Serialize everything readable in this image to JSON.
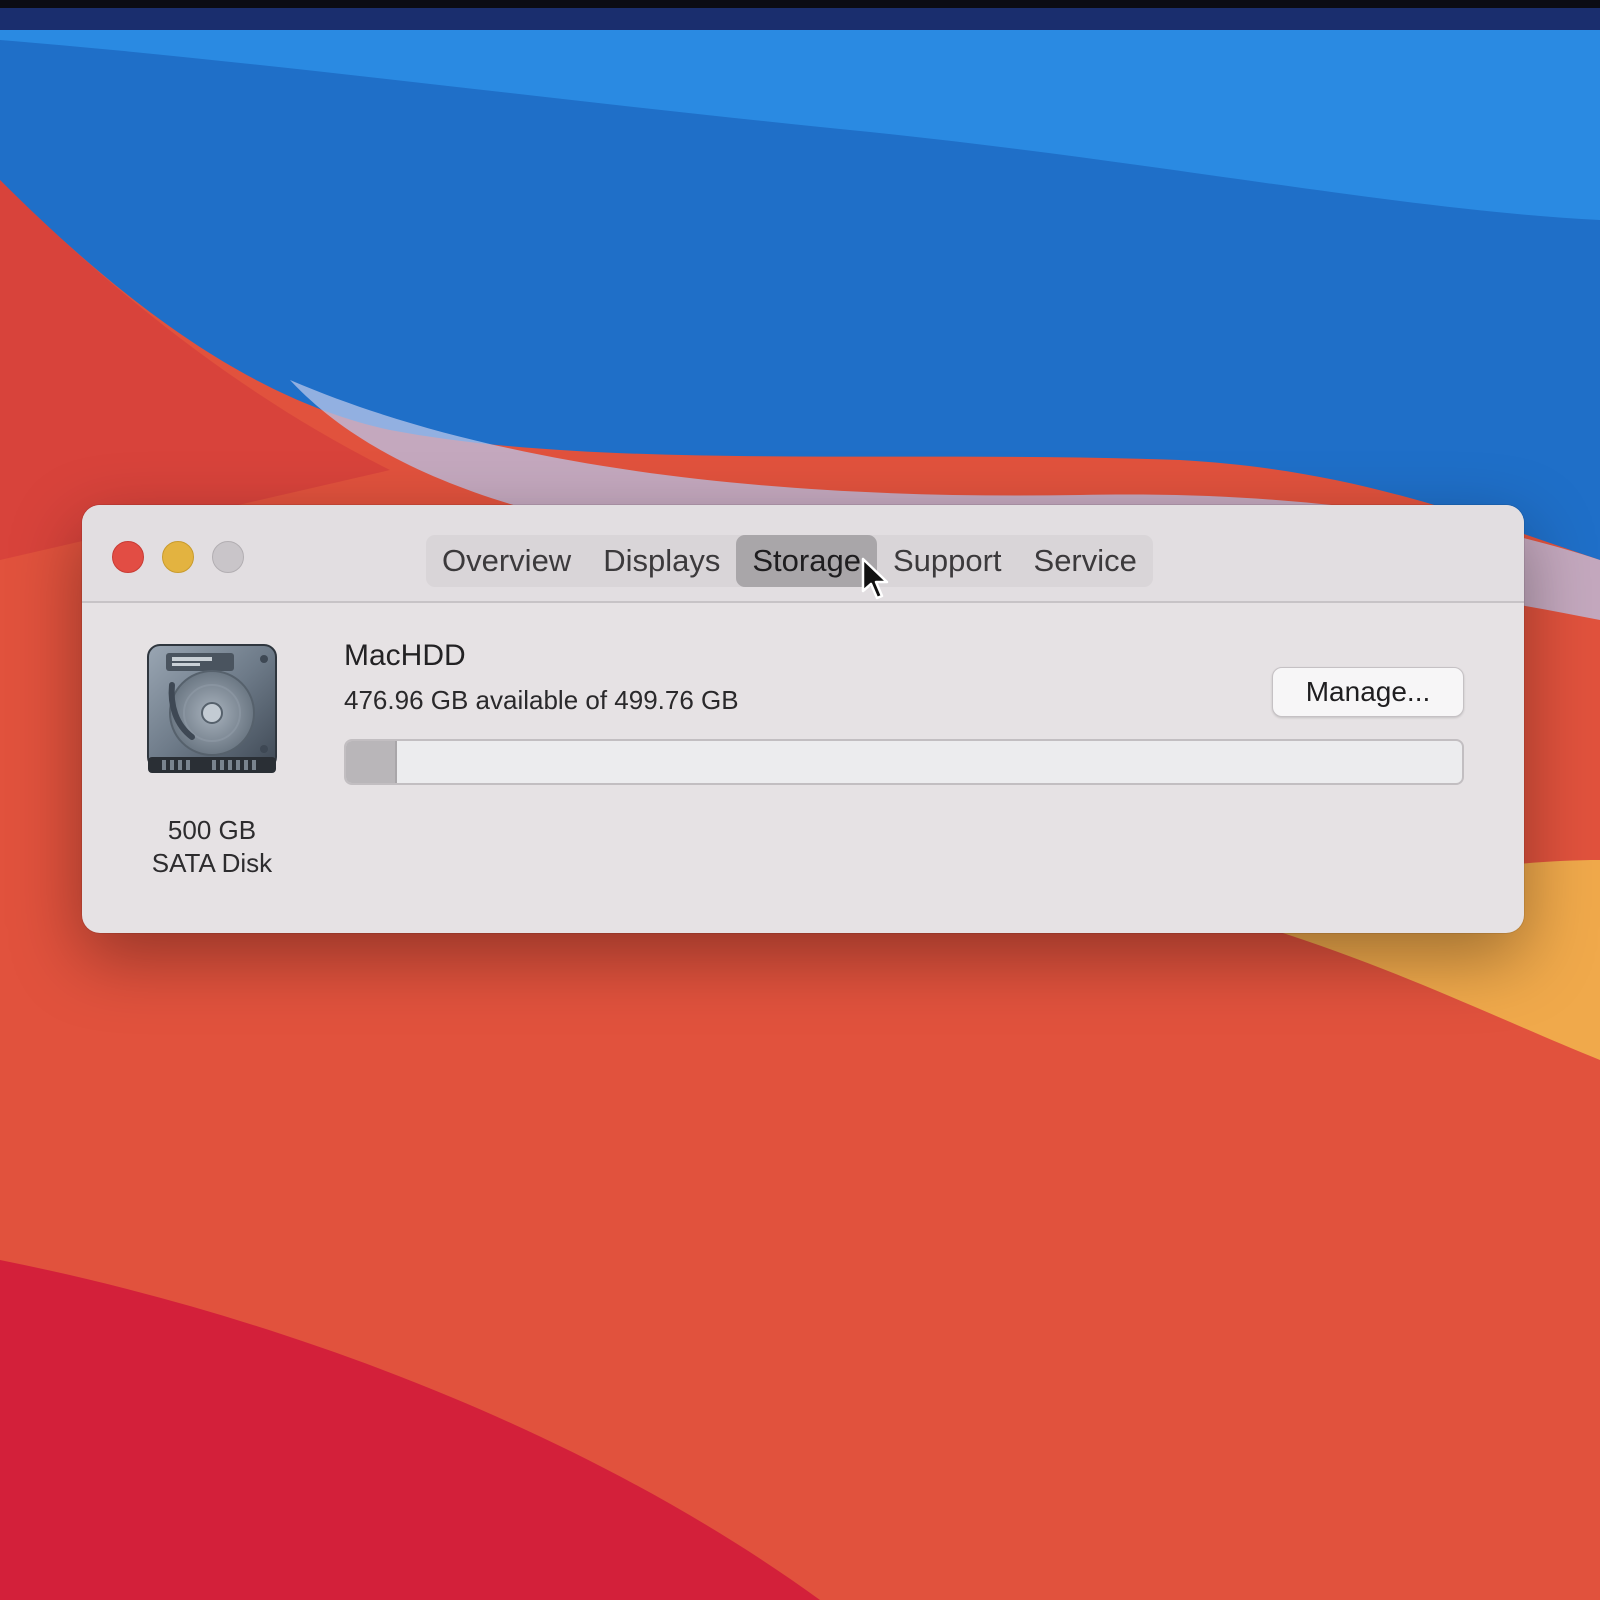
{
  "window": {
    "tabs": [
      {
        "label": "Overview",
        "active": false
      },
      {
        "label": "Displays",
        "active": false
      },
      {
        "label": "Storage",
        "active": true
      },
      {
        "label": "Support",
        "active": false
      },
      {
        "label": "Service",
        "active": false
      }
    ]
  },
  "storage": {
    "disk_size": "500 GB",
    "disk_type": "SATA Disk",
    "volume_name": "MacHDD",
    "usage_text": "476.96 GB available of 499.76 GB",
    "used_fraction": 0.0456,
    "manage_label": "Manage..."
  },
  "colors": {
    "close": "#e24d44",
    "minimize": "#e3b340",
    "zoom": "#c9c5c9",
    "wallpaper_blue": "#1f74d0",
    "wallpaper_red": "#e1453c"
  },
  "icons": {
    "disk": "hard-drive-icon",
    "cursor": "pointer-cursor-icon"
  }
}
